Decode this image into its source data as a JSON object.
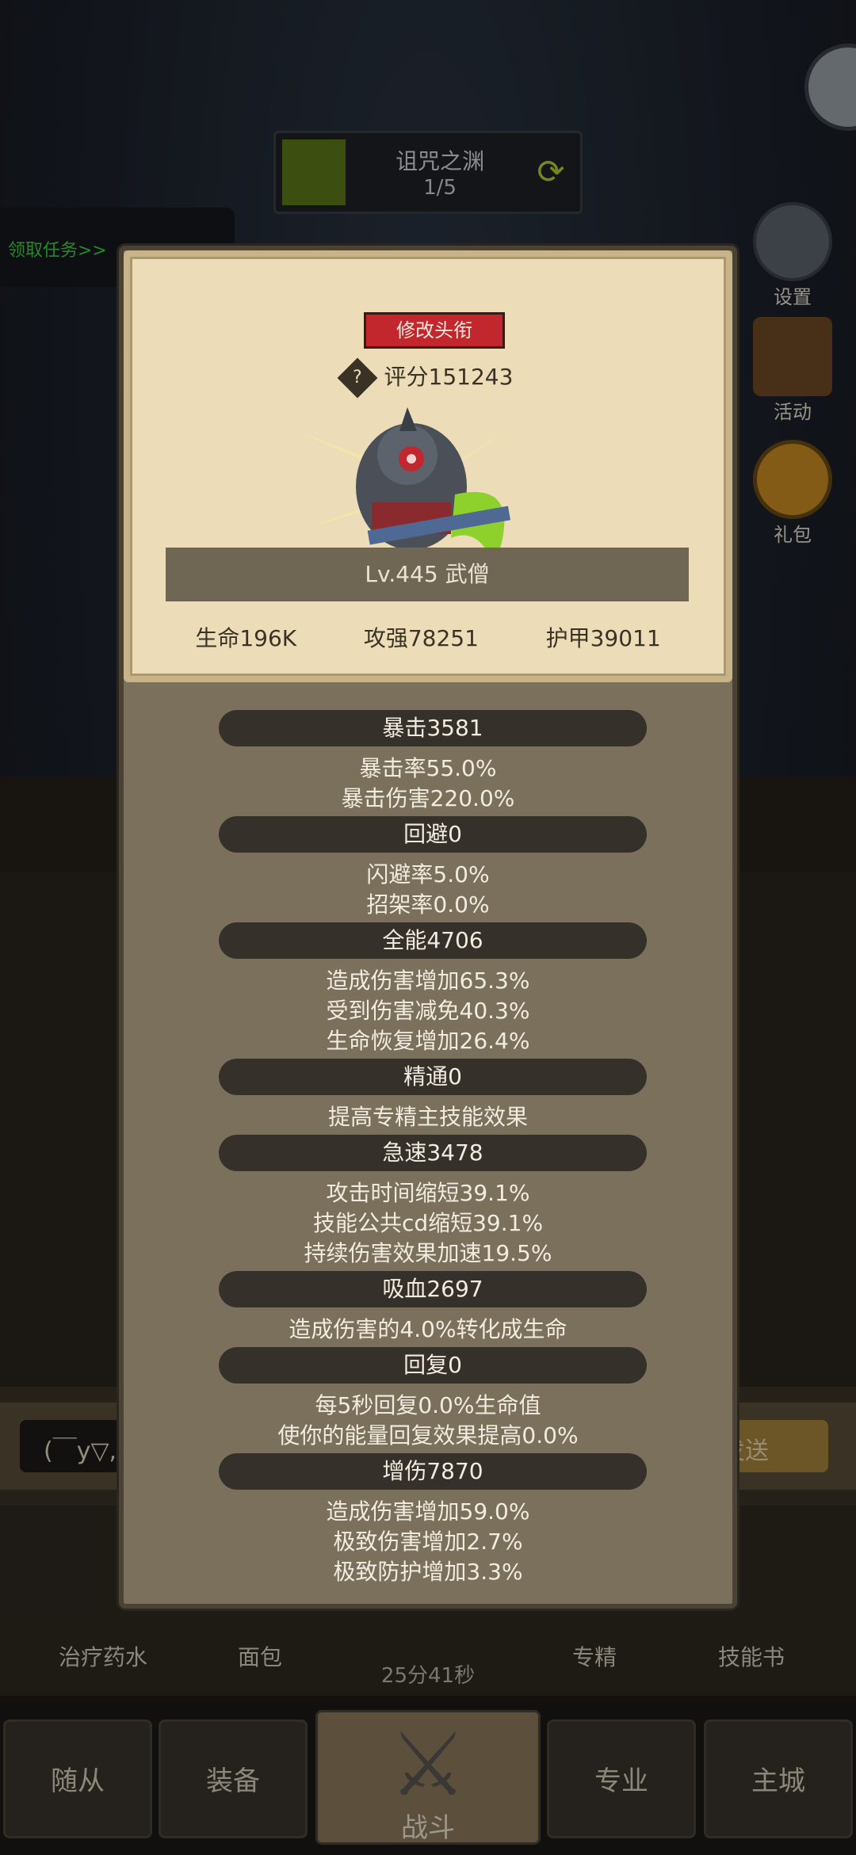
{
  "background": {
    "dungeon_name": "诅咒之渊",
    "dungeon_progress": "1/5",
    "quest_tab": "领取任务>>",
    "side_buttons": [
      {
        "label": "设置",
        "icon": "gear-icon"
      },
      {
        "label": "活动",
        "icon": "scroll-icon"
      },
      {
        "label": "礼包",
        "icon": "gift-icon"
      }
    ],
    "chat_input": "(￣y▽,",
    "chat_send": "发送",
    "consumables": [
      {
        "label": "治疗药水"
      },
      {
        "label": "面包"
      },
      {
        "label": "专精"
      },
      {
        "label": "技能书"
      }
    ],
    "timer": "25分41秒",
    "nav": [
      {
        "label": "随从"
      },
      {
        "label": "装备"
      },
      {
        "label": "战斗"
      },
      {
        "label": "专业"
      },
      {
        "label": "主城"
      }
    ]
  },
  "card": {
    "title_button": "修改头衔",
    "score": "评分151243",
    "level": "Lv.445 武僧",
    "hp": "生命196K",
    "attack": "攻强78251",
    "armor": "护甲39011"
  },
  "sections": [
    {
      "head": "暴击3581",
      "lines": [
        "暴击率55.0%",
        "暴击伤害220.0%"
      ]
    },
    {
      "head": "回避0",
      "lines": [
        "闪避率5.0%",
        "招架率0.0%"
      ]
    },
    {
      "head": "全能4706",
      "lines": [
        "造成伤害增加65.3%",
        "受到伤害减免40.3%",
        "生命恢复增加26.4%"
      ]
    },
    {
      "head": "精通0",
      "lines": [
        "提高专精主技能效果"
      ]
    },
    {
      "head": "急速3478",
      "lines": [
        "攻击时间缩短39.1%",
        "技能公共cd缩短39.1%",
        "持续伤害效果加速19.5%"
      ]
    },
    {
      "head": "吸血2697",
      "lines": [
        "造成伤害的4.0%转化成生命"
      ]
    },
    {
      "head": "回复0",
      "lines": [
        "每5秒回复0.0%生命值",
        "使你的能量回复效果提高0.0%"
      ]
    },
    {
      "head": "增伤7870",
      "lines": [
        "造成伤害增加59.0%",
        "极致伤害增加2.7%",
        "极致防护增加3.3%"
      ]
    }
  ]
}
